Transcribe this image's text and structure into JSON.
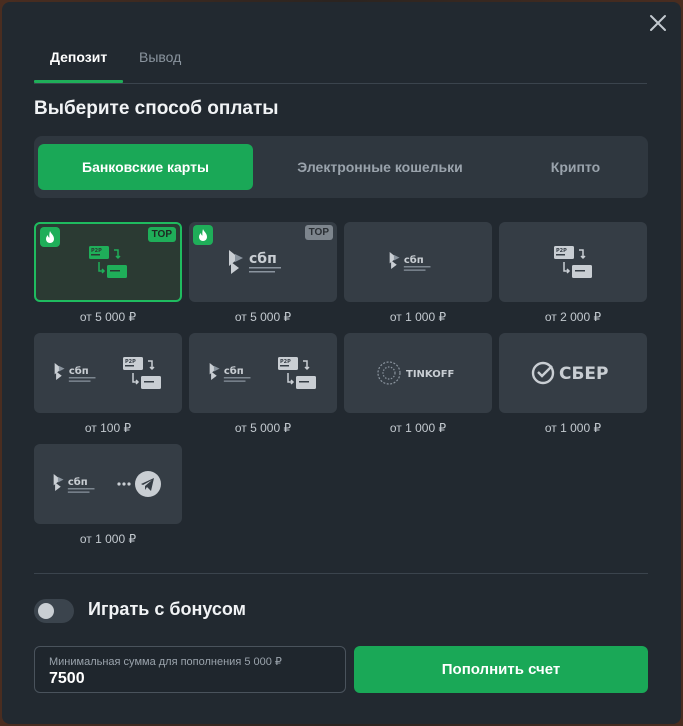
{
  "tabs": [
    {
      "label": "Депозит"
    },
    {
      "label": "Вывод"
    }
  ],
  "heading": "Выберите способ оплаты",
  "segments": [
    {
      "label": "Банковские карты"
    },
    {
      "label": "Электронные кошельки"
    },
    {
      "label": "Крипто"
    }
  ],
  "methods": [
    {
      "logo": "p2p-transfer-icon",
      "amount": "от 5 000 ₽",
      "hot": true,
      "badge": "TOP",
      "selected": true
    },
    {
      "logo": "sbp-logo",
      "amount": "от 5 000 ₽",
      "hot": true,
      "badge": "TOP",
      "selected": false
    },
    {
      "logo": "sbp-logo-small",
      "amount": "от 1 000 ₽",
      "hot": false,
      "badge": "",
      "selected": false
    },
    {
      "logo": "p2p-transfer-icon",
      "amount": "от 2 000 ₽",
      "hot": false,
      "badge": "",
      "selected": false
    },
    {
      "logo": "sbp-p2p-logo",
      "amount": "от 100 ₽",
      "hot": false,
      "badge": "",
      "selected": false
    },
    {
      "logo": "sbp-p2p-logo",
      "amount": "от 5 000 ₽",
      "hot": false,
      "badge": "",
      "selected": false
    },
    {
      "logo": "tinkoff-logo",
      "amount": "от 1 000 ₽",
      "hot": false,
      "badge": "",
      "selected": false
    },
    {
      "logo": "sber-logo",
      "amount": "от 1 000 ₽",
      "hot": false,
      "badge": "",
      "selected": false
    },
    {
      "logo": "sbp-telegram-logo",
      "amount": "от 1 000 ₽",
      "hot": false,
      "badge": "",
      "selected": false
    }
  ],
  "logo_text": {
    "sbp": "сбп",
    "tinkoff": "TINKOFF",
    "sber": "СБЕР"
  },
  "bonus": {
    "label": "Играть с бонусом",
    "enabled": false
  },
  "amount_field": {
    "hint": "Минимальная сумма для пополнения 5 000 ₽",
    "value": "7500"
  },
  "submit_label": "Пополнить счет",
  "colors": {
    "accent": "#1aa857",
    "panel": "#222930",
    "card": "#353d45"
  }
}
